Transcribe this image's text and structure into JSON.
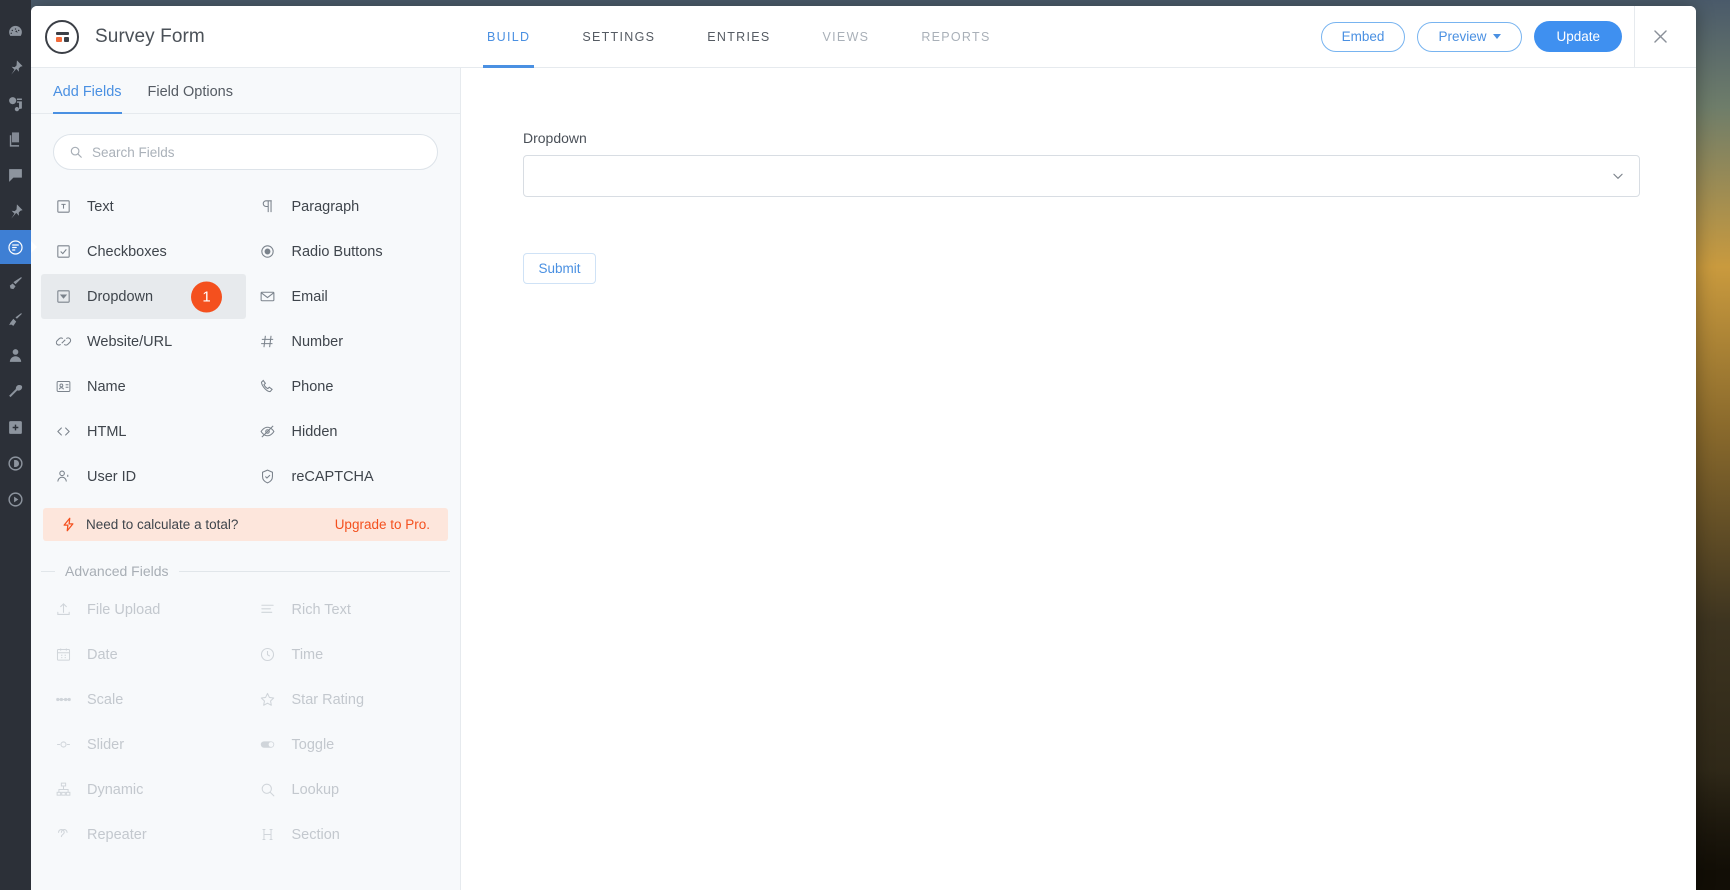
{
  "rail": {
    "items": [
      {
        "name": "dashboard-icon",
        "active": false
      },
      {
        "name": "pin-icon",
        "active": false
      },
      {
        "name": "media-icon",
        "active": false
      },
      {
        "name": "pages-icon",
        "active": false
      },
      {
        "name": "comments-icon",
        "active": false
      },
      {
        "name": "pin-alt-icon",
        "active": false
      },
      {
        "name": "formidable-icon",
        "active": true
      },
      {
        "name": "brush-icon",
        "active": false
      },
      {
        "name": "plugin-icon",
        "active": false
      },
      {
        "name": "users-icon",
        "active": false
      },
      {
        "name": "tools-icon",
        "active": false
      },
      {
        "name": "settings-grid-icon",
        "active": false
      },
      {
        "name": "divi-icon",
        "active": false
      },
      {
        "name": "play-icon",
        "active": false
      }
    ]
  },
  "header": {
    "form_title": "Survey Form",
    "tabs": [
      {
        "label": "BUILD",
        "state": "active"
      },
      {
        "label": "SETTINGS",
        "state": "normal"
      },
      {
        "label": "ENTRIES",
        "state": "normal"
      },
      {
        "label": "VIEWS",
        "state": "muted"
      },
      {
        "label": "REPORTS",
        "state": "muted"
      }
    ],
    "embed_label": "Embed",
    "preview_label": "Preview",
    "update_label": "Update",
    "close_icon": "close-icon"
  },
  "sidebar": {
    "tabs": [
      {
        "label": "Add Fields",
        "state": "active"
      },
      {
        "label": "Field Options",
        "state": "normal"
      }
    ],
    "search": {
      "placeholder": "Search Fields",
      "value": "",
      "icon": "search-icon"
    },
    "basic_fields": [
      {
        "label": "Text",
        "icon": "text-icon",
        "selected": false,
        "badge": null
      },
      {
        "label": "Paragraph",
        "icon": "paragraph-icon",
        "selected": false,
        "badge": null
      },
      {
        "label": "Checkboxes",
        "icon": "checkbox-icon",
        "selected": false,
        "badge": null
      },
      {
        "label": "Radio Buttons",
        "icon": "radio-icon",
        "selected": false,
        "badge": null
      },
      {
        "label": "Dropdown",
        "icon": "dropdown-icon",
        "selected": true,
        "badge": "1"
      },
      {
        "label": "Email",
        "icon": "email-icon",
        "selected": false,
        "badge": null
      },
      {
        "label": "Website/URL",
        "icon": "link-icon",
        "selected": false,
        "badge": null
      },
      {
        "label": "Number",
        "icon": "hash-icon",
        "selected": false,
        "badge": null
      },
      {
        "label": "Name",
        "icon": "name-card-icon",
        "selected": false,
        "badge": null
      },
      {
        "label": "Phone",
        "icon": "phone-icon",
        "selected": false,
        "badge": null
      },
      {
        "label": "HTML",
        "icon": "code-icon",
        "selected": false,
        "badge": null
      },
      {
        "label": "Hidden",
        "icon": "eye-off-icon",
        "selected": false,
        "badge": null
      },
      {
        "label": "User ID",
        "icon": "user-icon",
        "selected": false,
        "badge": null
      },
      {
        "label": "reCAPTCHA",
        "icon": "shield-check-icon",
        "selected": false,
        "badge": null
      }
    ],
    "upsell": {
      "icon": "bolt-icon",
      "text": "Need to calculate a total?",
      "link": "Upgrade to Pro."
    },
    "advanced_label": "Advanced Fields",
    "advanced_fields": [
      {
        "label": "File Upload",
        "icon": "upload-icon"
      },
      {
        "label": "Rich Text",
        "icon": "rich-text-icon"
      },
      {
        "label": "Date",
        "icon": "calendar-icon"
      },
      {
        "label": "Time",
        "icon": "clock-icon"
      },
      {
        "label": "Scale",
        "icon": "scale-icon"
      },
      {
        "label": "Star Rating",
        "icon": "star-icon"
      },
      {
        "label": "Slider",
        "icon": "slider-icon"
      },
      {
        "label": "Toggle",
        "icon": "toggle-icon"
      },
      {
        "label": "Dynamic",
        "icon": "dynamic-icon"
      },
      {
        "label": "Lookup",
        "icon": "lookup-icon"
      },
      {
        "label": "Repeater",
        "icon": "repeater-icon"
      },
      {
        "label": "Section",
        "icon": "section-icon"
      }
    ]
  },
  "canvas": {
    "field_label": "Dropdown",
    "dropdown_value": "",
    "chevron_icon": "chevron-down-icon",
    "submit_label": "Submit"
  },
  "colors": {
    "accent_blue": "#4a90e2",
    "primary_button": "#3f90f0",
    "badge_orange": "#f4501e",
    "upsell_bg": "#fde6dc",
    "sidebar_bg": "#f7f9fb",
    "rail_bg": "#2c3038"
  }
}
